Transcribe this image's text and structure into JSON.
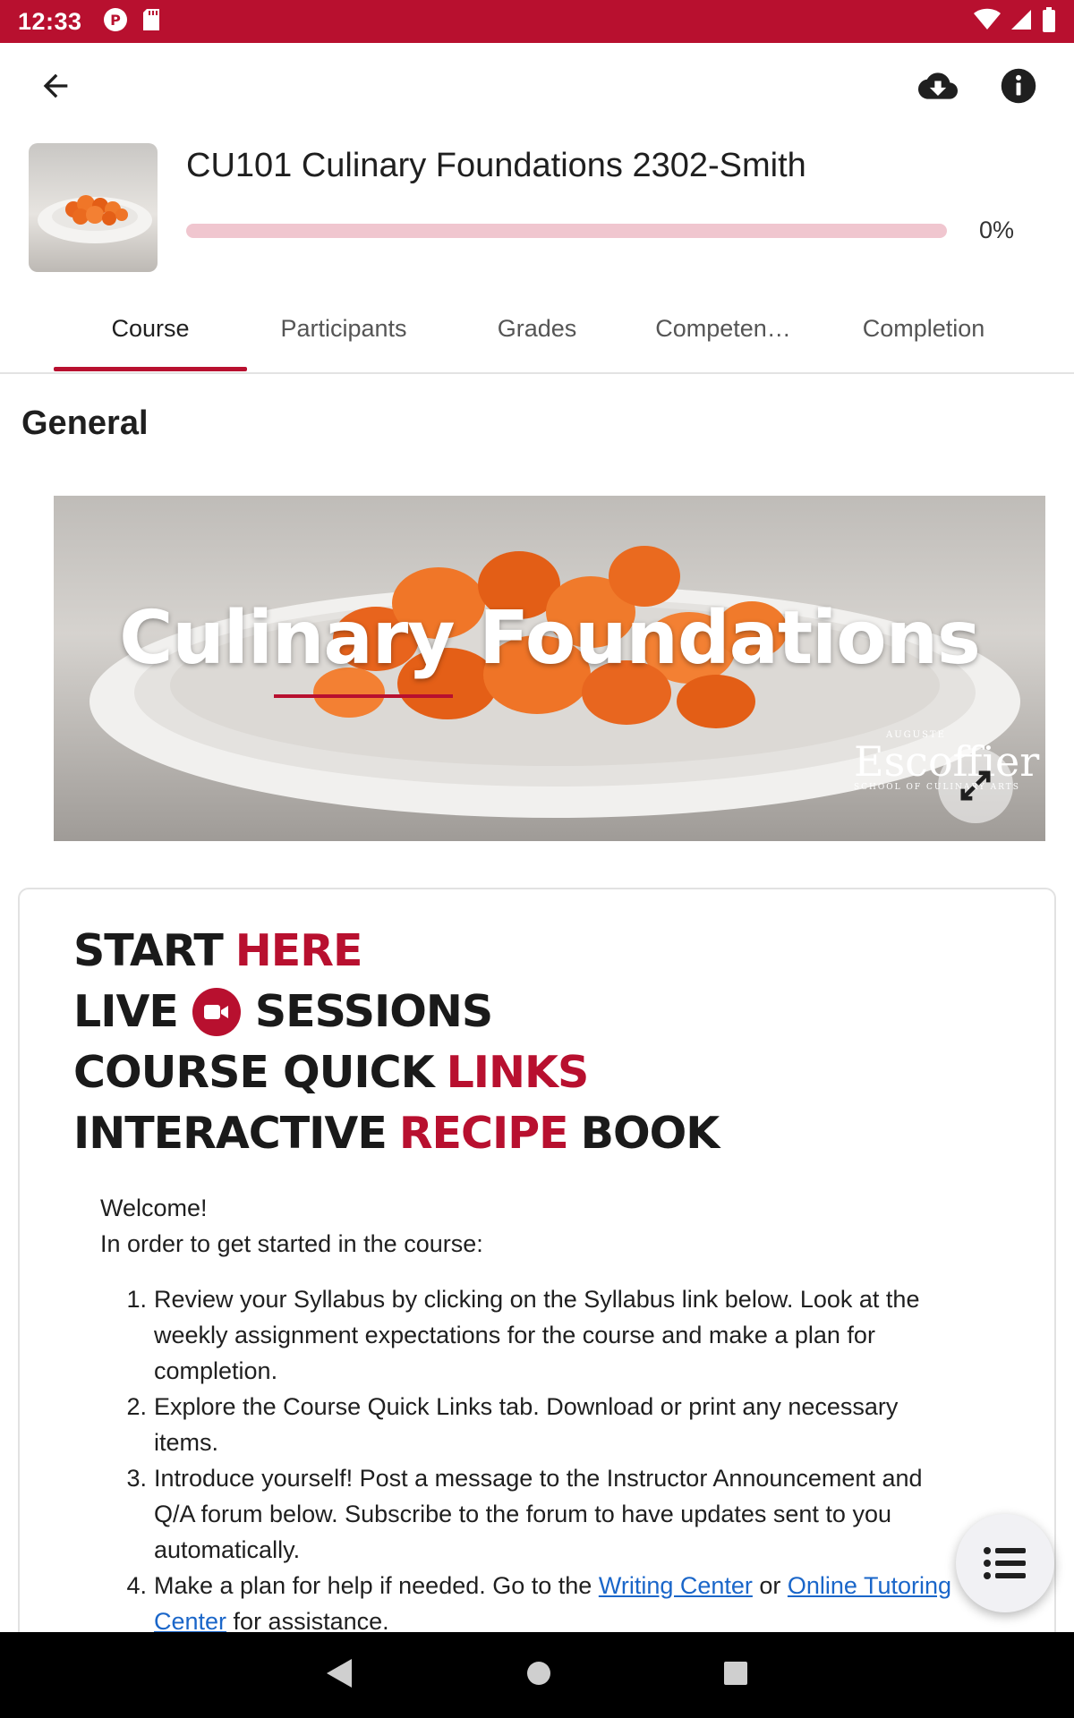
{
  "status_bar": {
    "time": "12:33"
  },
  "course": {
    "title": "CU101 Culinary Foundations 2302-Smith",
    "progress_percent": 0,
    "progress_text": "0%"
  },
  "tabs": [
    {
      "label": "Course",
      "active": true
    },
    {
      "label": "Participants",
      "active": false
    },
    {
      "label": "Grades",
      "active": false
    },
    {
      "label": "Competen…",
      "active": false
    },
    {
      "label": "Completion",
      "active": false
    }
  ],
  "section": {
    "title": "General"
  },
  "banner": {
    "title": "Culinary Foundations",
    "brand_top": "AUGUSTE",
    "brand_name": "Escoffier",
    "brand_sub": "SCHOOL OF CULINARY ARTS"
  },
  "quick_links": {
    "start": [
      "START ",
      "HERE"
    ],
    "live": [
      "LIVE",
      "SESSIONS"
    ],
    "course_links": [
      "COURSE QUICK ",
      "LINKS"
    ],
    "recipe": [
      "INTERACTIVE ",
      "RECIPE",
      " BOOK"
    ]
  },
  "welcome": {
    "line1": "Welcome!",
    "line2": "In order to get started in the course:"
  },
  "steps": [
    {
      "num": "1.",
      "text": "Review your Syllabus by clicking on the Syllabus link below. Look at the weekly assignment expectations for the course and make a plan for completion."
    },
    {
      "num": "2.",
      "text": "Explore the Course Quick Links tab. Download or print any necessary items."
    },
    {
      "num": "3.",
      "text": "Introduce yourself! Post a message to the Instructor Announcement and Q/A forum below. Subscribe to the forum to have updates sent to you automatically."
    }
  ],
  "step4": {
    "num": "4.",
    "prefix": "Make a plan for help if needed. Go to the ",
    "link1": "Writing Center",
    "middle": " or ",
    "link2": "Online Tutoring Center",
    "suffix": " for assistance."
  },
  "colors": {
    "brand_red": "#b8102f",
    "link_blue": "#1a66c9"
  }
}
